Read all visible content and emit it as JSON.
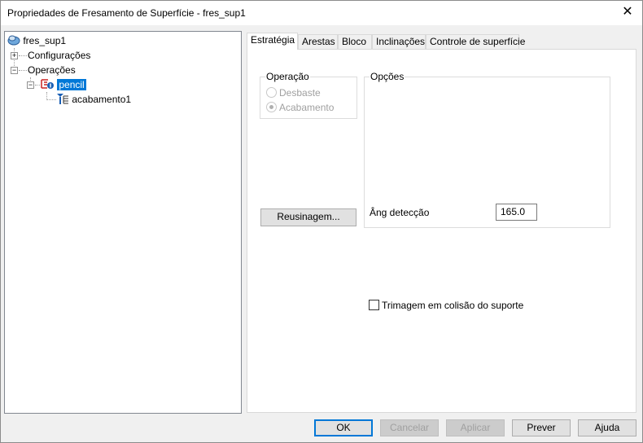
{
  "window": {
    "title": "Propriedades de Fresamento de Superfície - fres_sup1",
    "close_glyph": "✕"
  },
  "tree": {
    "root": "fres_sup1",
    "configuracoes": "Configurações",
    "operacoes": "Operações",
    "pencil": "pencil",
    "acabamento": "acabamento1",
    "expand_plus": "+",
    "expand_minus": "−"
  },
  "tabs": [
    "Estratégia",
    "Arestas",
    "Bloco",
    "Inclinações",
    "Controle de superfície"
  ],
  "strategy": {
    "operacao_group": "Operação",
    "desbaste": "Desbaste",
    "acabamento": "Acabamento",
    "opcoes_group": "Opções",
    "ang_label": "Âng detecção",
    "ang_value": "165.0",
    "reusinagem": "Reusinagem...",
    "trimagem": "Trimagem em colisão do suporte"
  },
  "buttons": {
    "ok": "OK",
    "cancelar": "Cancelar",
    "aplicar": "Aplicar",
    "prever": "Prever",
    "ajuda": "Ajuda"
  },
  "colors": {
    "selection": "#0078d7",
    "icon_blue": "#1a5fb4",
    "icon_red": "#cc2222"
  },
  "icons": [
    "project-icon",
    "surface-mill-icon",
    "tool-path-icon"
  ]
}
